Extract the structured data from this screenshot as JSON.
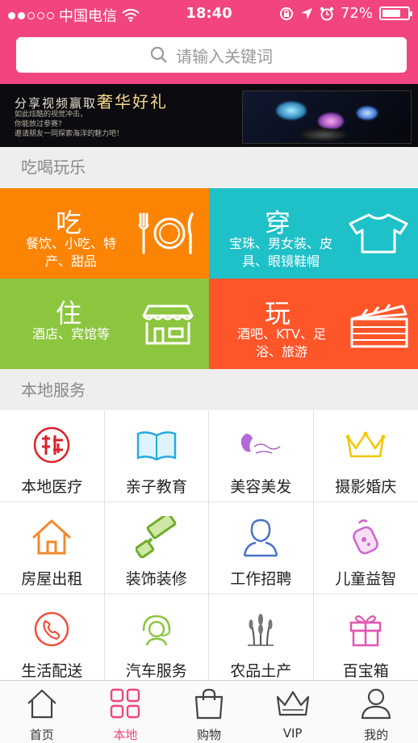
{
  "status_bar": {
    "carrier": "中国电信",
    "time": "18:40",
    "battery": "72%",
    "battery_level": 0.72
  },
  "search": {
    "placeholder": "请输入关键词",
    "icon": "search-icon"
  },
  "banner": {
    "headline_prefix": "分享视频赢取",
    "headline_highlight": "奢华好礼",
    "sub_lines": [
      "如此炫酷的视觉冲击，",
      "你能放过参赛?",
      "邀请朋友一同探索海洋的魅力吧！"
    ]
  },
  "sections": {
    "fun": "吃喝玩乐",
    "local": "本地服务"
  },
  "categories": [
    {
      "title": "吃",
      "desc": "餐饮、小吃、特产、甜品",
      "color": "#fc8405",
      "icon": "utensils-icon"
    },
    {
      "title": "穿",
      "desc": "宝珠、男女装、皮具、眼镜鞋帽",
      "color": "#1ec1c8",
      "icon": "tshirt-icon"
    },
    {
      "title": "住",
      "desc": "酒店、宾馆等",
      "color": "#8cc63f",
      "icon": "shop-icon"
    },
    {
      "title": "玩",
      "desc": "酒吧、KTV、足浴、旅游",
      "color": "#fe5529",
      "icon": "clapperboard-icon"
    }
  ],
  "services": [
    {
      "label": "本地医疗",
      "icon": "medical-seal-icon",
      "color": "#d8232a"
    },
    {
      "label": "亲子教育",
      "icon": "book-icon",
      "color": "#27aadf"
    },
    {
      "label": "美容美发",
      "icon": "salon-logo-icon",
      "color": "#9b4fc0"
    },
    {
      "label": "摄影婚庆",
      "icon": "crown-icon",
      "color": "#f2d200"
    },
    {
      "label": "房屋出租",
      "icon": "house-icon",
      "color": "#f28a2e"
    },
    {
      "label": "装饰装修",
      "icon": "paint-roller-icon",
      "color": "#8cc63f"
    },
    {
      "label": "工作招聘",
      "icon": "person-icon",
      "color": "#4a72c6"
    },
    {
      "label": "儿童益智",
      "icon": "baby-bottle-icon",
      "color": "#cc66cc"
    },
    {
      "label": "生活配送",
      "icon": "phone-delivery-icon",
      "color": "#f0503c"
    },
    {
      "label": "汽车服务",
      "icon": "headset-icon",
      "color": "#8cc63f"
    },
    {
      "label": "农品土产",
      "icon": "wheat-icon",
      "color": "#555555"
    },
    {
      "label": "百宝箱",
      "icon": "gift-icon",
      "color": "#e255b0"
    }
  ],
  "tabbar": {
    "items": [
      {
        "label": "首页",
        "icon": "home-icon"
      },
      {
        "label": "本地",
        "icon": "grid-icon",
        "active": true
      },
      {
        "label": "购物",
        "icon": "shopping-bag-icon"
      },
      {
        "label": "VIP",
        "icon": "vip-crown-icon"
      },
      {
        "label": "我的",
        "icon": "user-icon"
      }
    ],
    "accent": "#f2457f"
  }
}
